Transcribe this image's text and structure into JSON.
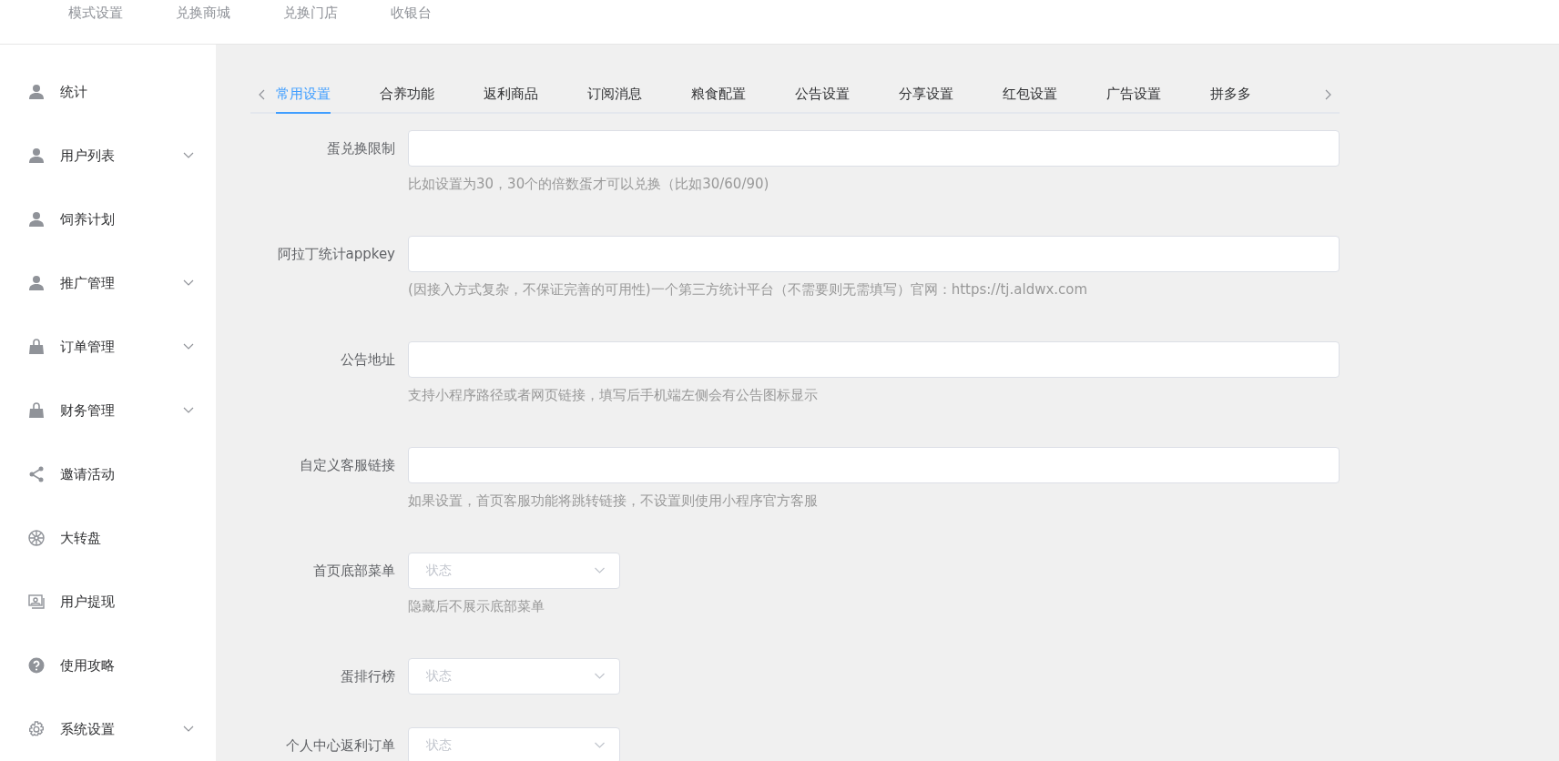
{
  "top_nav": [
    "模式设置",
    "兑换商城",
    "兑换门店",
    "收银台"
  ],
  "sidebar": {
    "items": [
      {
        "label": "统计",
        "has_submenu": false
      },
      {
        "label": "用户列表",
        "has_submenu": true
      },
      {
        "label": "饲养计划",
        "has_submenu": false
      },
      {
        "label": "推广管理",
        "has_submenu": true
      },
      {
        "label": "订单管理",
        "has_submenu": true
      },
      {
        "label": "财务管理",
        "has_submenu": true
      },
      {
        "label": "邀请活动",
        "has_submenu": false
      },
      {
        "label": "大转盘",
        "has_submenu": false
      },
      {
        "label": "用户提现",
        "has_submenu": false
      },
      {
        "label": "使用攻略",
        "has_submenu": false
      },
      {
        "label": "系统设置",
        "has_submenu": true
      }
    ]
  },
  "tabs": [
    {
      "label": "常用设置",
      "selected": true
    },
    {
      "label": "合养功能",
      "selected": false
    },
    {
      "label": "返利商品",
      "selected": false
    },
    {
      "label": "订阅消息",
      "selected": false
    },
    {
      "label": "粮食配置",
      "selected": false
    },
    {
      "label": "公告设置",
      "selected": false
    },
    {
      "label": "分享设置",
      "selected": false
    },
    {
      "label": "红包设置",
      "selected": false
    },
    {
      "label": "广告设置",
      "selected": false
    },
    {
      "label": "拼多多",
      "selected": false
    }
  ],
  "form": {
    "fields": [
      {
        "kind": "input",
        "label": "蛋兑换限制",
        "hint": "比如设置为30，30个的倍数蛋才可以兑换（比如30/60/90)"
      },
      {
        "kind": "input",
        "label": "阿拉丁统计appkey",
        "hint": "(因接入方式复杂，不保证完善的可用性)一个第三方统计平台（不需要则无需填写）官网：https://tj.aldwx.com"
      },
      {
        "kind": "input",
        "label": "公告地址",
        "hint": "支持小程序路径或者网页链接，填写后手机端左侧会有公告图标显示"
      },
      {
        "kind": "input",
        "label": "自定义客服链接",
        "hint": "如果设置，首页客服功能将跳转链接，不设置则使用小程序官方客服"
      },
      {
        "kind": "select",
        "label": "首页底部菜单",
        "placeholder": "状态",
        "hint": "隐藏后不展示底部菜单"
      },
      {
        "kind": "select",
        "label": "蛋排行榜",
        "placeholder": "状态"
      },
      {
        "kind": "select",
        "label": "个人中心返利订单",
        "placeholder": "状态"
      }
    ]
  }
}
